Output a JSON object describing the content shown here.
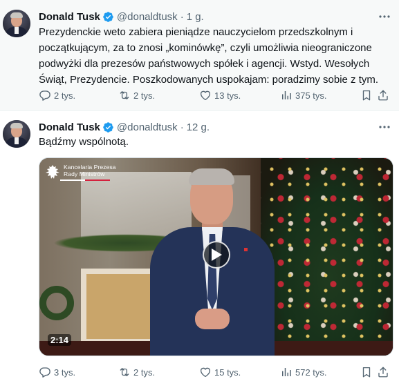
{
  "colors": {
    "accent": "#1d9bf0",
    "text": "#0f1419",
    "muted": "#536471",
    "row_bg": "#f7f9f9"
  },
  "tweets": [
    {
      "author_name": "Donald Tusk",
      "handle": "@donaldtusk",
      "separator": "·",
      "time": "1 g.",
      "text_lines": [
        "Prezydenckie weto zabiera pieniądze nauczycielom przedszkolnym i",
        "początkującym, za to znosi „kominówkę”, czyli umożliwia nieograniczone",
        "podwyżki dla prezesów państwowych spółek i agencji. Wstyd. Wesołych",
        "Świąt, Prezydencie. Poszkodowanych uspokajam: poradzimy sobie z tym."
      ],
      "replies": "2 tys.",
      "reposts": "2 tys.",
      "likes": "13 tys.",
      "views": "375 tys.",
      "icons": [
        "verified-badge-icon",
        "more-icon",
        "reply-icon",
        "repost-icon",
        "like-icon",
        "views-icon",
        "bookmark-icon",
        "share-icon"
      ]
    },
    {
      "author_name": "Donald Tusk",
      "handle": "@donaldtusk",
      "separator": "·",
      "time": "12 g.",
      "text_lines": [
        "Bądźmy wspólnotą."
      ],
      "video": {
        "logo_text_line1": "Kancelaria Prezesa",
        "logo_text_line2": "Rady Ministrów",
        "duration": "2:14"
      },
      "replies": "3 tys.",
      "reposts": "2 tys.",
      "likes": "15 tys.",
      "views": "572 tys.",
      "icons": [
        "verified-badge-icon",
        "more-icon",
        "play-icon",
        "reply-icon",
        "repost-icon",
        "like-icon",
        "views-icon",
        "bookmark-icon",
        "share-icon"
      ]
    }
  ]
}
